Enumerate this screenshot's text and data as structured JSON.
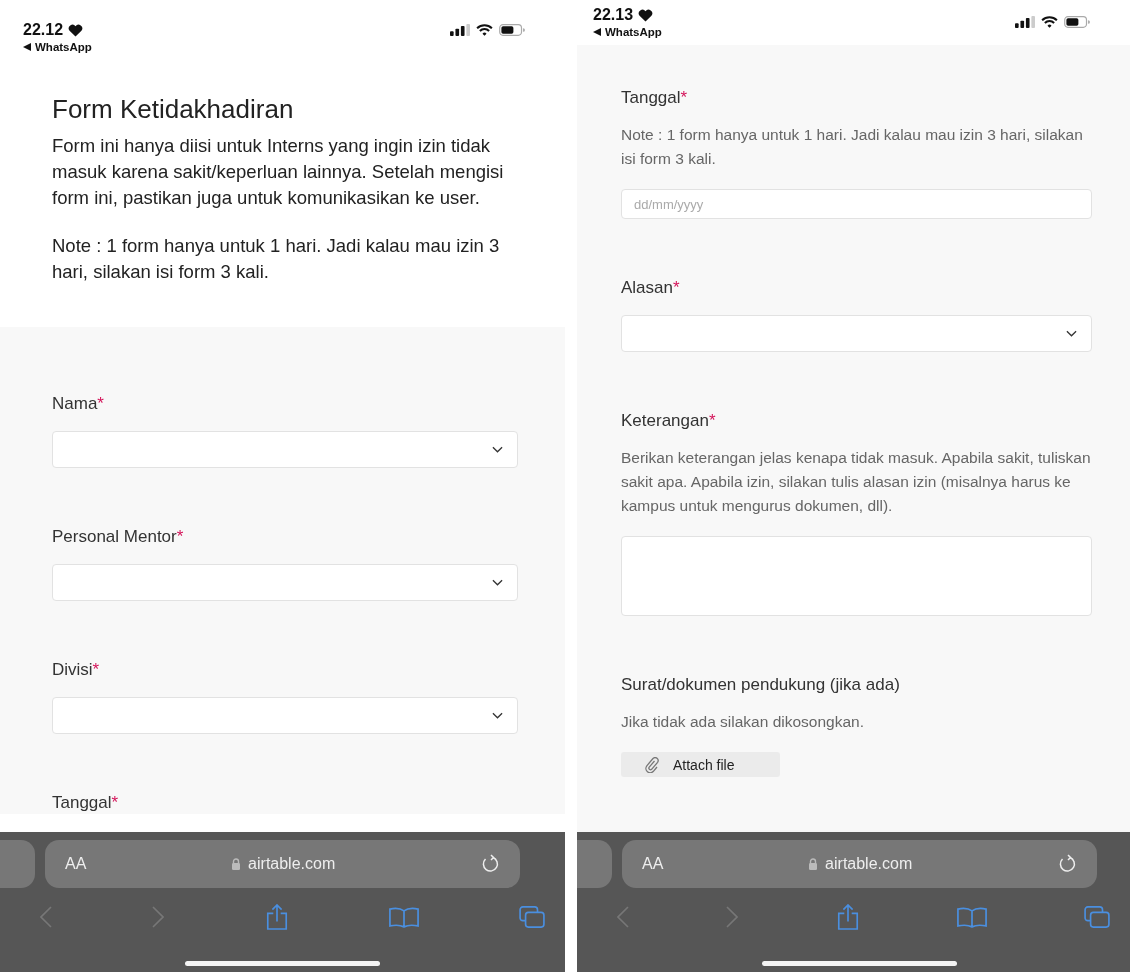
{
  "phones": [
    {
      "status_bar": {
        "time": "22.12",
        "back_app": "WhatsApp"
      },
      "header": {
        "title": "Form Ketidakhadiran",
        "description": "Form ini hanya diisi untuk Interns yang ingin izin tidak masuk karena sakit/keperluan lainnya. Setelah mengisi form ini, pastikan juga untuk komunikasikan ke user.",
        "note": "Note : 1 form hanya untuk 1 hari. Jadi kalau mau izin 3 hari, silakan isi form 3 kali."
      },
      "fields": [
        {
          "kind": "select",
          "label": "Nama",
          "required_mark": "*"
        },
        {
          "kind": "select",
          "label": "Personal Mentor",
          "required_mark": "*"
        },
        {
          "kind": "select",
          "label": "Divisi",
          "required_mark": "*"
        },
        {
          "kind": "label",
          "label": "Tanggal",
          "required_mark": "*"
        }
      ],
      "browser": {
        "text_size_button": "AA",
        "url": "airtable.com"
      }
    },
    {
      "status_bar": {
        "time": "22.13",
        "back_app": "WhatsApp"
      },
      "fields": [
        {
          "kind": "date",
          "label": "Tanggal",
          "required_mark": "*",
          "description": "Note : 1 form hanya untuk 1 hari. Jadi kalau mau izin 3 hari, silakan isi form 3 kali.",
          "placeholder": "dd/mm/yyyy"
        },
        {
          "kind": "select",
          "label": "Alasan",
          "required_mark": "*"
        },
        {
          "kind": "textarea",
          "label": "Keterangan",
          "required_mark": "*",
          "description": "Berikan keterangan jelas kenapa tidak masuk. Apabila sakit, tuliskan sakit apa. Apabila izin, silakan tulis alasan izin (misalnya harus ke kampus untuk mengurus dokumen, dll)."
        },
        {
          "kind": "attachment",
          "label": "Surat/dokumen pendukung (jika ada)",
          "description": "Jika tidak ada silakan dikosongkan.",
          "button": "Attach file"
        }
      ],
      "browser": {
        "text_size_button": "AA",
        "url": "airtable.com"
      }
    }
  ]
}
